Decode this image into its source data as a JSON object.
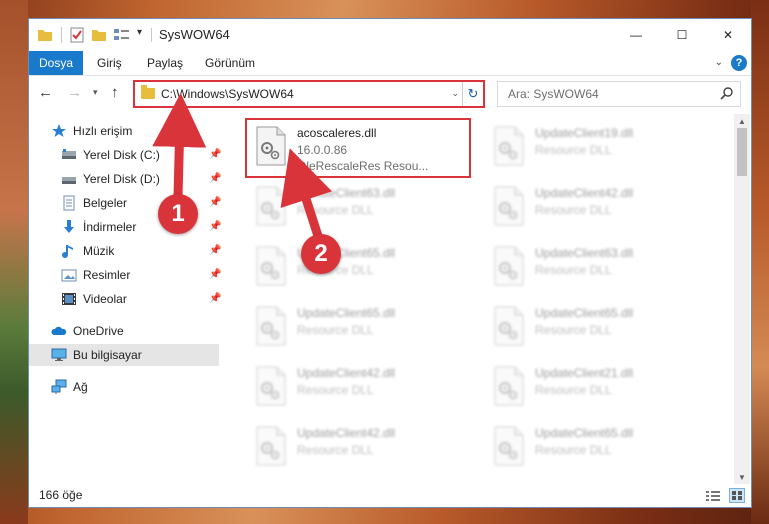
{
  "window": {
    "title": "SysWOW64",
    "controls": {
      "minimize": "—",
      "maximize": "☐",
      "close": "✕"
    }
  },
  "ribbon": {
    "tabs": [
      "Dosya",
      "Giriş",
      "Paylaş",
      "Görünüm"
    ],
    "help": "?"
  },
  "navigation": {
    "address_path": "C:\\Windows\\SysWOW64",
    "search_placeholder": "Ara: SysWOW64"
  },
  "sidebar": {
    "quick_access": "Hızlı erişim",
    "items": [
      {
        "label": "Yerel Disk (C:)",
        "icon": "drive-icon",
        "pinned": true
      },
      {
        "label": "Yerel Disk (D:)",
        "icon": "drive-icon",
        "pinned": true
      },
      {
        "label": "Belgeler",
        "icon": "documents-icon",
        "pinned": true
      },
      {
        "label": "İndirmeler",
        "icon": "download-icon",
        "pinned": true
      },
      {
        "label": "Müzik",
        "icon": "music-icon",
        "pinned": true
      },
      {
        "label": "Resimler",
        "icon": "pictures-icon",
        "pinned": true
      },
      {
        "label": "Videolar",
        "icon": "videos-icon",
        "pinned": true
      }
    ],
    "onedrive": "OneDrive",
    "this_pc": "Bu bilgisayar",
    "network": "Ağ"
  },
  "files": [
    {
      "name": "acoscaleres.dll",
      "line2": "16.0.0.86",
      "line3": "OleRescaleRes Resou...",
      "highlighted": true
    },
    {
      "name": "UpdateClient19.dll",
      "line2": "Resource DLL",
      "blurred": true
    },
    {
      "name": "UpdateClient63.dll",
      "line2": "Resource DLL",
      "blurred": true
    },
    {
      "name": "UpdateClient42.dll",
      "line2": "Resource DLL",
      "blurred": true
    },
    {
      "name": "UpdateClient65.dll",
      "line2": "Resource DLL",
      "blurred": true
    },
    {
      "name": "UpdateClient63.dll",
      "line2": "Resource DLL",
      "blurred": true
    },
    {
      "name": "UpdateClient65.dll",
      "line2": "Resource DLL",
      "blurred": true
    },
    {
      "name": "UpdateClient65.dll",
      "line2": "Resource DLL",
      "blurred": true
    },
    {
      "name": "UpdateClient42.dll",
      "line2": "Resource DLL",
      "blurred": true
    },
    {
      "name": "UpdateClient21.dll",
      "line2": "Resource DLL",
      "blurred": true
    },
    {
      "name": "UpdateClient42.dll",
      "line2": "Resource DLL",
      "blurred": true
    },
    {
      "name": "UpdateClient65.dll",
      "line2": "Resource DLL",
      "blurred": true
    }
  ],
  "status": {
    "item_count": "166 öğe"
  },
  "annotations": {
    "step1": "1",
    "step2": "2",
    "color": "#d9343a"
  },
  "colors": {
    "accent": "#1979ca",
    "highlight": "#d9343a"
  }
}
